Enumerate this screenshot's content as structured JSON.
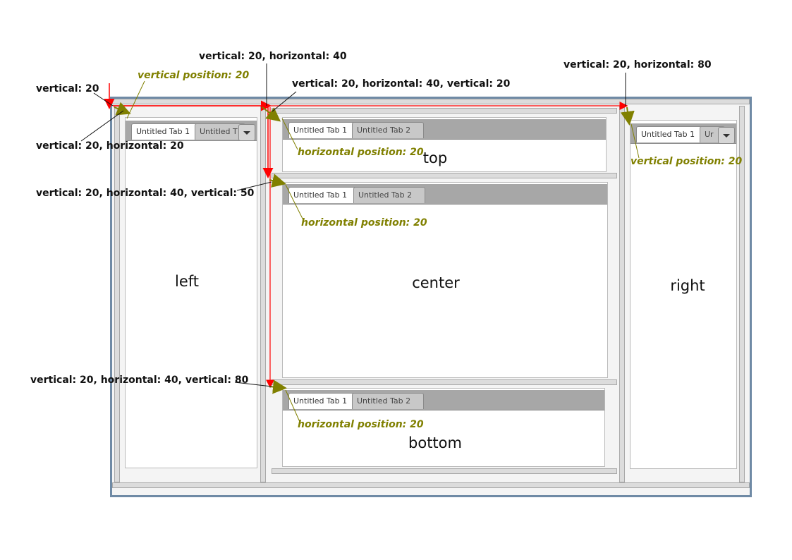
{
  "regions": {
    "left": "left",
    "top": "top",
    "center": "center",
    "right": "right",
    "bottom": "bottom"
  },
  "tabs": {
    "left": {
      "tab1": "Untitled Tab 1",
      "tab2": "Untitled T"
    },
    "top": {
      "tab1": "Untitled Tab 1",
      "tab2": "Untitled Tab 2"
    },
    "center": {
      "tab1": "Untitled Tab 1",
      "tab2": "Untitled Tab 2"
    },
    "bottom": {
      "tab1": "Untitled Tab 1",
      "tab2": "Untitled Tab 2"
    },
    "right": {
      "tab1": "Untitled Tab 1",
      "tab2": "Ur"
    }
  },
  "annotations": {
    "v20": "vertical: 20",
    "v20_h20": "vertical: 20, horizontal: 20",
    "v20_h40": "vertical: 20, horizontal: 40",
    "v20_h40_v20": "vertical: 20, horizontal: 40, vertical: 20",
    "v20_h40_v50": "vertical: 20, horizontal: 40, vertical: 50",
    "v20_h40_v80": "vertical: 20, horizontal: 40, vertical: 80",
    "v20_h80": "vertical: 20, horizontal: 80",
    "vpos_left": "vertical position: 20",
    "vpos_right": "vertical position: 20",
    "hpos_top": "horizontal position: 20",
    "hpos_center": "horizontal position: 20",
    "hpos_bottom": "horizontal position: 20"
  },
  "colors": {
    "frame_border": "#6f8aa5",
    "arrow_red": "#ff0000",
    "arrow_olive": "#808000",
    "tab_strip": "#a7a7a7"
  }
}
